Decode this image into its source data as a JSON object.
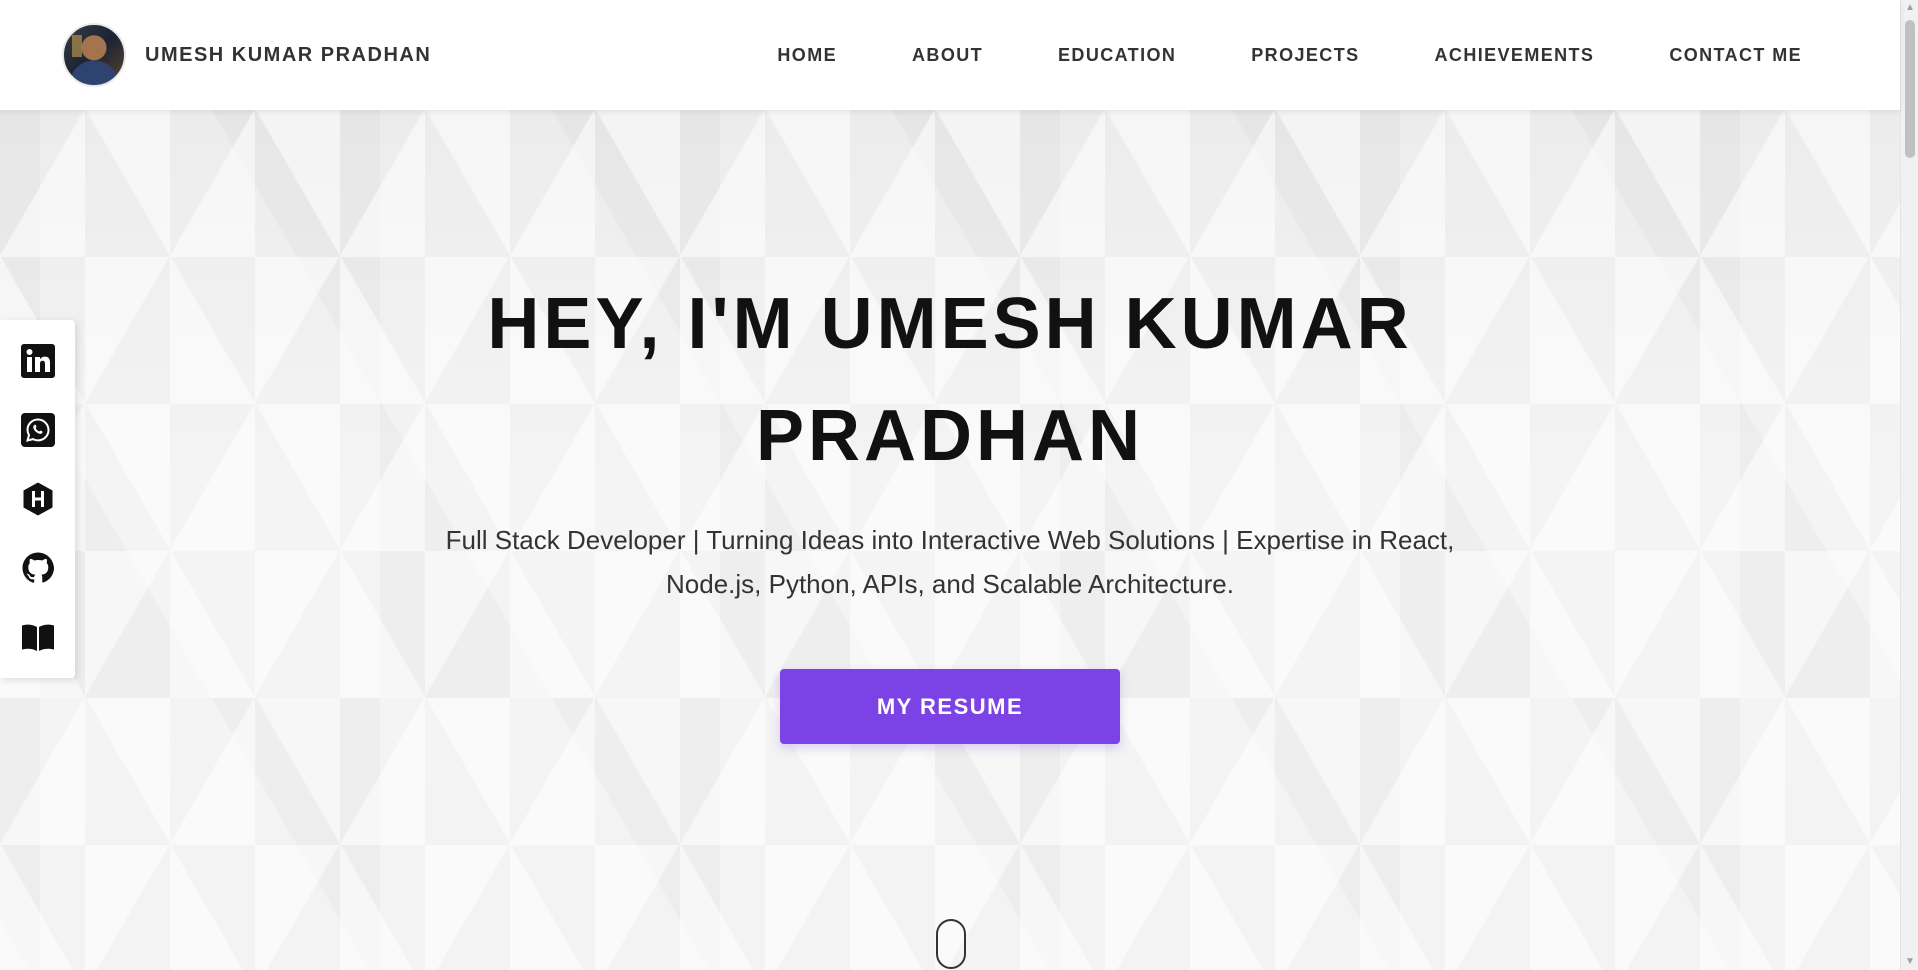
{
  "header": {
    "brand_name": "UMESH KUMAR PRADHAN",
    "nav": [
      {
        "label": "HOME"
      },
      {
        "label": "ABOUT"
      },
      {
        "label": "EDUCATION"
      },
      {
        "label": "PROJECTS"
      },
      {
        "label": "ACHIEVEMENTS"
      },
      {
        "label": "CONTACT ME"
      }
    ]
  },
  "hero": {
    "title_line1": "HEY, I'M UMESH KUMAR",
    "title_line2": "PRADHAN",
    "subtitle": "Full Stack Developer | Turning Ideas into Interactive Web Solutions | Expertise in React, Node.js, Python, APIs, and Scalable Architecture.",
    "resume_button": "MY RESUME"
  },
  "social": [
    "linkedin-icon",
    "whatsapp-icon",
    "hashnode-icon",
    "github-icon",
    "book-icon"
  ],
  "colors": {
    "accent": "#7b43e6",
    "text_dark": "#111111",
    "text_body": "#333333",
    "hero_bg": "#f2f2f2"
  }
}
